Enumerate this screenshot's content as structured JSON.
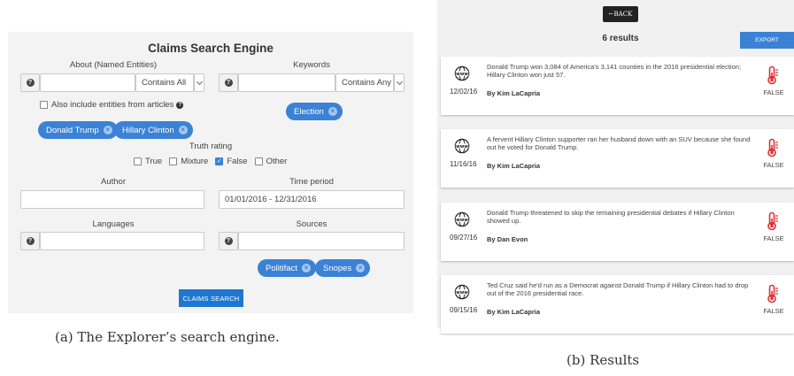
{
  "search": {
    "title": "Claims Search Engine",
    "about_label": "About (Named Entities)",
    "about_value": "",
    "about_mode": "Contains All",
    "keywords_label": "Keywords",
    "keywords_value": "",
    "keywords_mode": "Contains Any",
    "include_articles_label": "Also include entities from articles",
    "include_articles_checked": false,
    "entity_chips": [
      "Donald Trump",
      "Hillary Clinton"
    ],
    "keyword_chips": [
      "Election"
    ],
    "truth_label": "Truth rating",
    "truth_options": [
      {
        "label": "True",
        "checked": false
      },
      {
        "label": "Mixture",
        "checked": false
      },
      {
        "label": "False",
        "checked": true
      },
      {
        "label": "Other",
        "checked": false
      }
    ],
    "author_label": "Author",
    "author_value": "",
    "time_label": "Time period",
    "time_value": "01/01/2016 - 12/31/2016",
    "languages_label": "Languages",
    "languages_value": "",
    "sources_label": "Sources",
    "sources_value": "",
    "source_chips": [
      "Politifact",
      "Snopes"
    ],
    "search_button": "CLAIMS SEARCH",
    "chip_close": "×",
    "help_glyph": "?",
    "accent_color": "#3b82d6"
  },
  "results_view": {
    "back_label": "BACK",
    "count_label": "6 results",
    "export_label": "EXPORT",
    "results": [
      {
        "date": "12/02/16",
        "text": "Donald Trump won 3,084 of America's 3,141 counties in the 2016 presidential election; Hillary Clinton won just 57.",
        "author": "By Kim LaCapria",
        "rating": "FALSE"
      },
      {
        "date": "11/16/16",
        "text": "A fervent Hillary Clinton supporter ran her husband down with an SUV because she found out he voted for Donald Trump.",
        "author": "By Kim LaCapria",
        "rating": "FALSE"
      },
      {
        "date": "09/27/16",
        "text": "Donald Trump threatened to skip the remaining presidential debates if Hillary Clinton showed up.",
        "author": "By Dan Evon",
        "rating": "FALSE"
      },
      {
        "date": "09/15/16",
        "text": "Ted Cruz said he'd run as a Democrat against Donald Trump if Hillary Clinton had to drop out of the 2016 presidential race.",
        "author": "By Kim LaCapria",
        "rating": "FALSE"
      }
    ],
    "false_color": "#e03030",
    "globe_icon": "globe-www-icon",
    "thermometer_icon": "thermometer-icon"
  },
  "captions": {
    "left": "(a) The Explorer’s search engine.",
    "right": "(b) Results"
  }
}
